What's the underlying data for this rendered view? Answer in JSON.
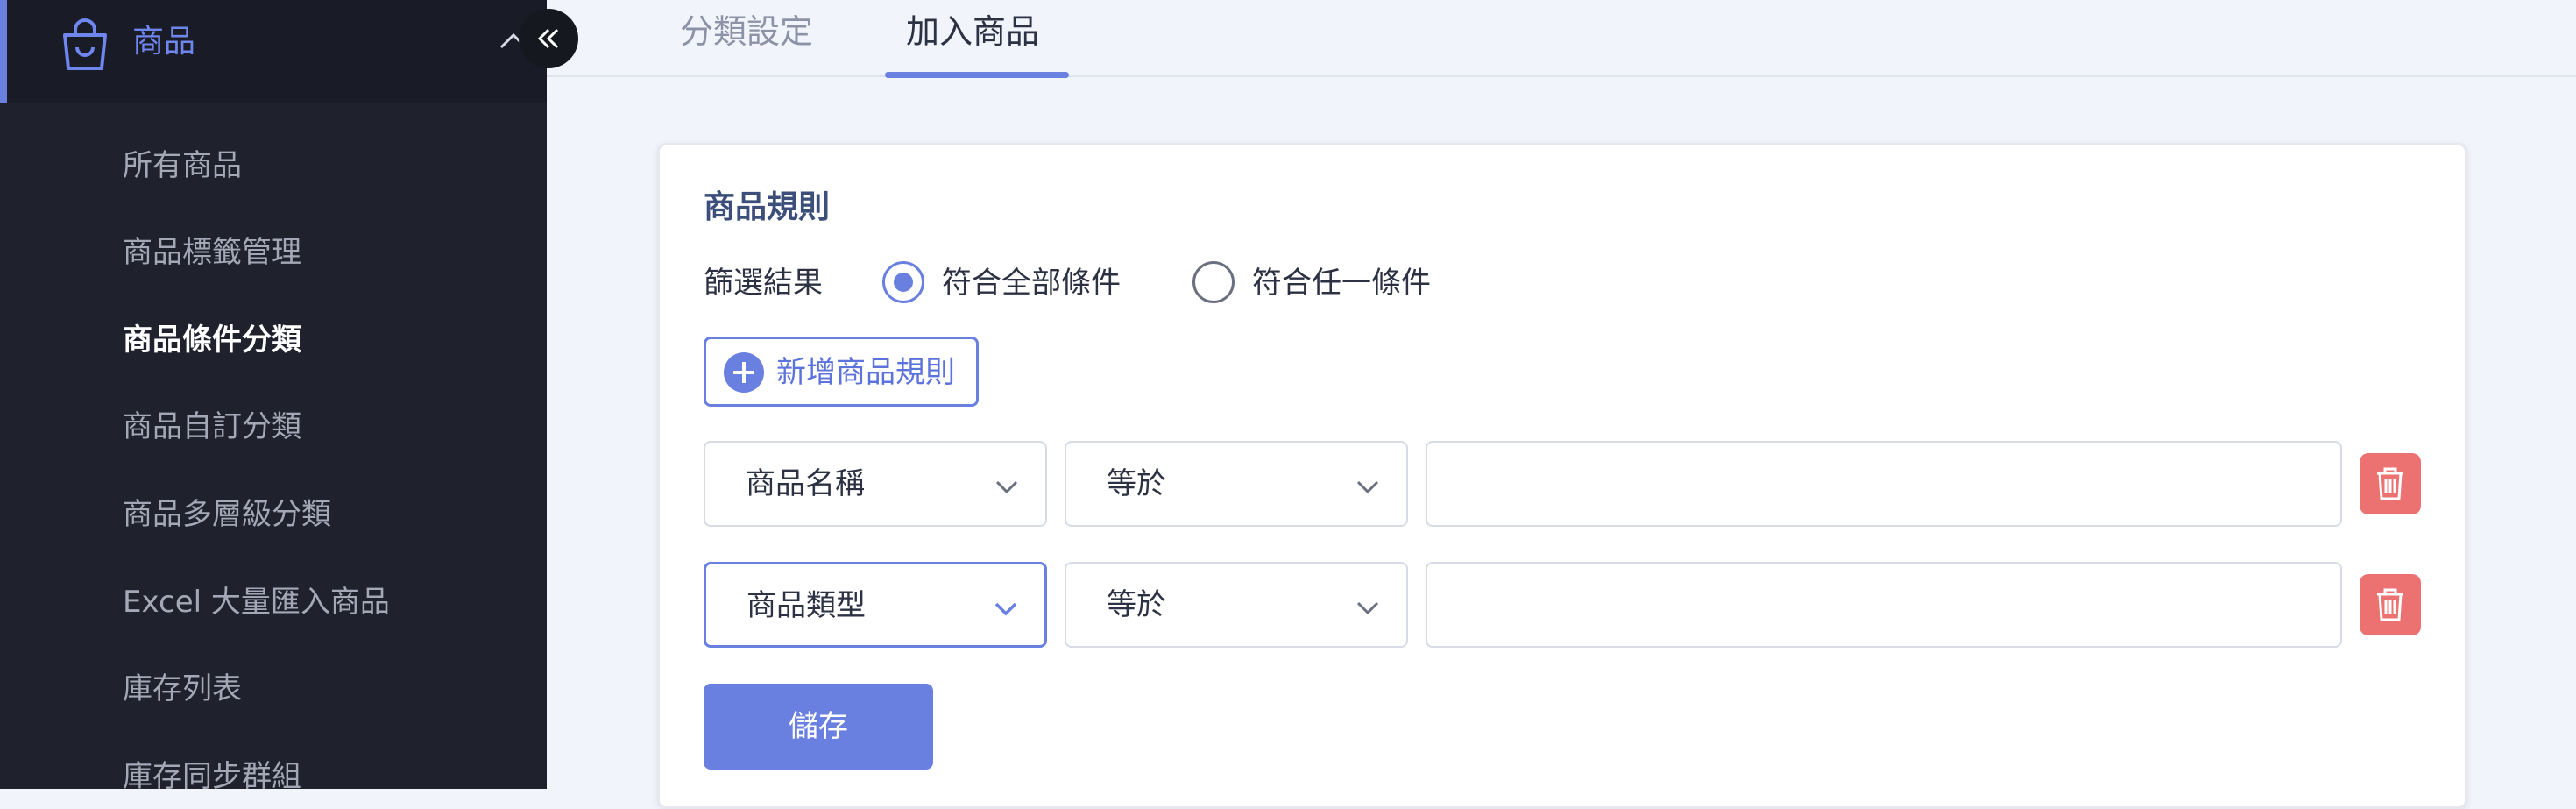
{
  "sidebar": {
    "title": "商品",
    "items": [
      {
        "label": "所有商品"
      },
      {
        "label": "商品標籤管理"
      },
      {
        "label": "商品條件分類",
        "active": true
      },
      {
        "label": "商品自訂分類"
      },
      {
        "label": "商品多層級分類"
      },
      {
        "label": "Excel 大量匯入商品"
      },
      {
        "label": "庫存列表"
      },
      {
        "label": "庫存同步群組"
      }
    ]
  },
  "tabs": [
    {
      "label": "分類設定",
      "active": false
    },
    {
      "label": "加入商品",
      "active": true
    }
  ],
  "rules": {
    "title": "商品規則",
    "filter_label": "篩選結果",
    "options": [
      {
        "label": "符合全部條件",
        "checked": true
      },
      {
        "label": "符合任一條件",
        "checked": false
      }
    ],
    "add_rule_label": "新增商品規則",
    "rows": [
      {
        "field": "商品名稱",
        "operator": "等於",
        "value": ""
      },
      {
        "field": "商品類型",
        "operator": "等於",
        "value": ""
      }
    ],
    "save_label": "儲存"
  },
  "colors": {
    "accent": "#6a80e0",
    "sidebar_bg": "#1f222d",
    "danger": "#ec7171",
    "page_bg": "#f2f4fb"
  },
  "icons": {
    "sidebar_header": "shopping-bag-icon",
    "collapse": "double-chevron-left-icon",
    "expand_state": "chevron-up-icon",
    "add": "plus-circle-icon",
    "delete": "trash-icon",
    "dropdown": "chevron-down-icon"
  }
}
